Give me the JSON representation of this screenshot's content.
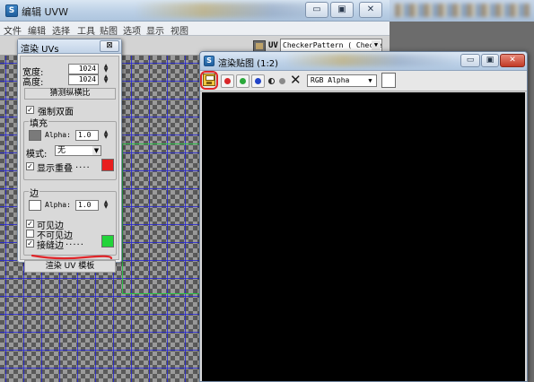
{
  "main_window": {
    "title": "编辑 UVW",
    "app_icon": "3ds-max-icon",
    "buttons": {
      "minimize": "▭",
      "maximize": "▣",
      "close": "✕"
    }
  },
  "menubar": {
    "items": [
      "文件",
      "编辑",
      "选择",
      "工具",
      "贴图",
      "选项",
      "显示",
      "视图"
    ]
  },
  "uvw_toolbar": {
    "uv_label": "UV",
    "map_select": "CheckerPattern  ( Checker"
  },
  "render_uvs": {
    "title": "渲染 UVs",
    "close": "⊠",
    "width_label": "宽度:",
    "width_value": "1024",
    "height_label": "高度:",
    "height_value": "1024",
    "guess_aspect": "猜测纵横比",
    "force_2sided": "强制双面",
    "force_2sided_checked": true,
    "fill_group": "填充",
    "fill_alpha_label": "Alpha:",
    "fill_alpha_value": "1.0",
    "fill_color": "#7a7a7a",
    "mode_label": "模式:",
    "mode_value": "无",
    "show_overlap": "显示重叠",
    "show_overlap_checked": true,
    "overlap_color": "#e81e1e",
    "edge_group": "边",
    "edge_alpha_label": "Alpha:",
    "edge_alpha_value": "1.0",
    "edge_color": "#ffffff",
    "visible_edges": "可见边",
    "visible_edges_checked": true,
    "invisible_edges": "不可见边",
    "invisible_edges_checked": false,
    "seam_edges": "接缝边",
    "seam_edges_checked": true,
    "seam_color": "#22d43a",
    "render_button": "渲染 UV 模板"
  },
  "render_map": {
    "title": "渲染贴图 (1:2)",
    "channel_select": "RGB Alpha",
    "channels": [
      {
        "name": "red-channel",
        "color": "#d8262a"
      },
      {
        "name": "green-channel",
        "color": "#2aa83a"
      },
      {
        "name": "blue-channel",
        "color": "#2244c8"
      },
      {
        "name": "alpha-channel",
        "color": "#8a8a8a"
      }
    ],
    "buttons": {
      "minimize": "▭",
      "maximize": "▣",
      "close": "✕"
    }
  }
}
